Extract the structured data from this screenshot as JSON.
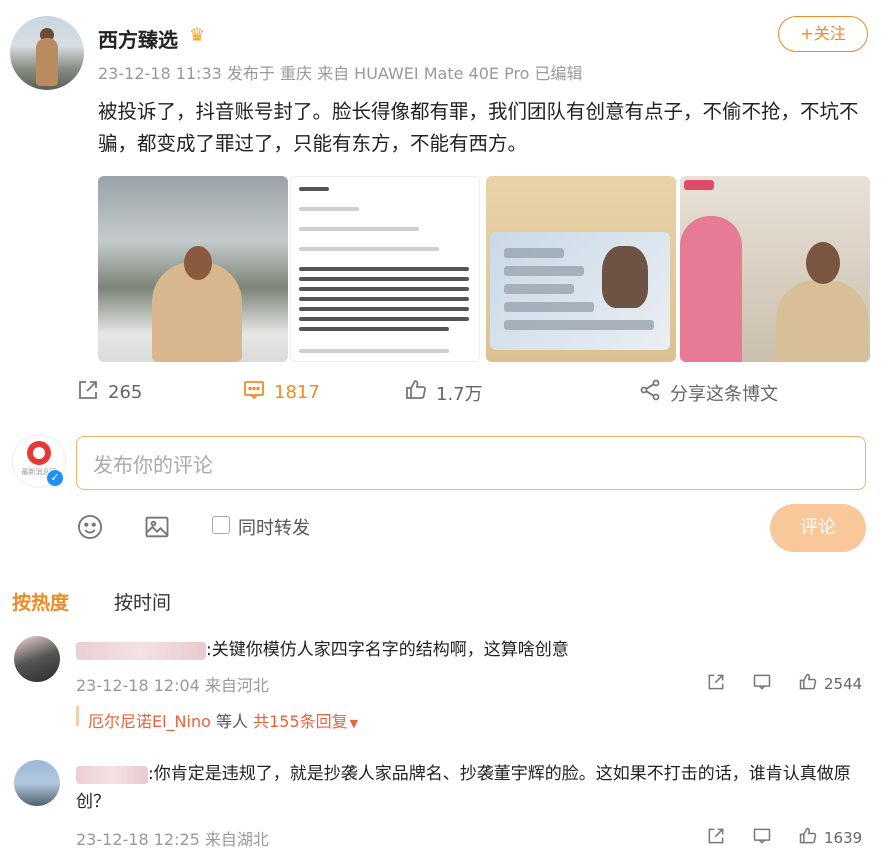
{
  "post": {
    "author": "西方臻选",
    "meta": "23-12-18 11:33 发布于 重庆 来自 HUAWEI Mate 40E Pro 已编辑",
    "follow_label": "+关注",
    "content": "被投诉了，抖音账号封了。脸长得像都有罪，我们团队有创意有点子，不偷不抢，不坑不骗，都变成了罪过了，只能有东方，不能有西方。",
    "actions": {
      "repost": "265",
      "comments": "1817",
      "likes": "1.7万",
      "share": "分享这条博文"
    },
    "crown_icon": "crown-icon"
  },
  "composer": {
    "placeholder": "发布你的评论",
    "repost_label": "同时转发",
    "submit_label": "评论",
    "avatar_caption": "最新消息网"
  },
  "sort_tabs": [
    "按热度",
    "按时间"
  ],
  "comments": [
    {
      "text": ":关键你模仿人家四字名字的结构啊，这算啥创意",
      "meta": "23-12-18 12:04 来自河北",
      "likes": "2544",
      "replies": {
        "name": "厄尔尼诺El_Nino",
        "mid": " 等人 ",
        "count": "共155条回复"
      }
    },
    {
      "text": ":你肯定是违规了，就是抄袭人家品牌名、抄袭董宇辉的脸。这如果不打击的话，谁肯认真做原创？",
      "meta": "23-12-18 12:25 来自湖北",
      "likes": "1639"
    }
  ],
  "colors": {
    "accent": "#f08a24",
    "submit_disabled": "#f8c89a",
    "reply_link": "#e8633b"
  }
}
